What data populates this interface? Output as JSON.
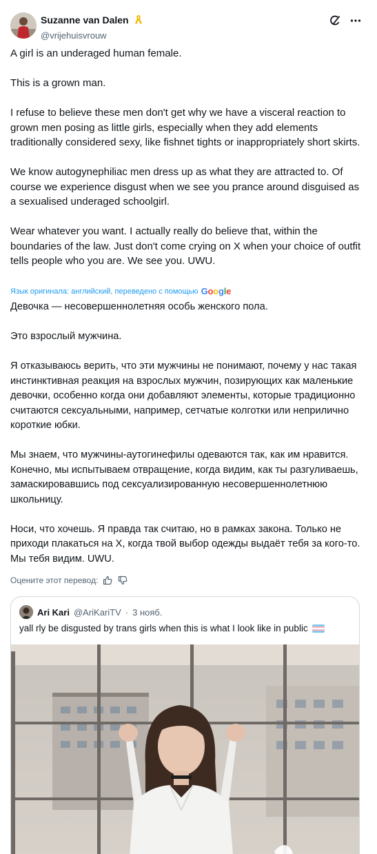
{
  "author": {
    "display_name": "Suzanne van Dalen",
    "handle": "@vrijehuisvrouw",
    "badge_icon": "awareness-ribbon-icon"
  },
  "header_icons": [
    "grok-icon",
    "more-icon"
  ],
  "original_paragraphs": [
    "A girl is an underaged human female.",
    "This is a grown man.",
    "I refuse to believe these men don't get why we have a visceral reaction to grown men posing as little girls, especially when they add elements traditionally considered sexy, like fishnet tights or inappropriately short skirts.",
    "We know autogynephiliac men dress up as what they are attracted to. Of course we experience disgust when we see you prance around disguised as a sexualised underaged schoolgirl.",
    "Wear whatever you want. I actually really do believe that, within the boundaries of the law. Just don't come crying on X when your choice of outfit tells people who you are. We see you. UWU."
  ],
  "translation": {
    "note": "Язык оригинала: английский, переведено с помощью",
    "provider": "Google",
    "paragraphs": [
      "Девочка — несовершеннолетняя особь женского пола.",
      "Это взрослый мужчина.",
      "Я отказываюсь верить, что эти мужчины не понимают, почему у нас такая инстинктивная реакция на взрослых мужчин, позирующих как маленькие девочки, особенно когда они добавляют элементы, которые традиционно считаются сексуальными, например, сетчатые колготки или неприлично короткие юбки.",
      "Мы знаем, что мужчины-аутогинефилы одеваются так, как им нравится. Конечно, мы испытываем отвращение, когда видим, как ты разгуливаешь, замаскировавшись под сексуализированную несовершеннолетнюю школьницу.",
      "Носи, что хочешь. Я правда так считаю, но в рамках закона. Только не приходи плакаться на X, когда твой выбор одежды выдаёт тебя за кого-то. Мы тебя видим. UWU."
    ],
    "rate_label": "Оцените этот перевод:"
  },
  "quote": {
    "display_name": "Ari Kari",
    "handle": "@AriKariTV",
    "separator": "·",
    "date": "3 нояб.",
    "text": "yall rly be disgusted by trans girls when this is what I look like in public",
    "flag_icon": "transgender-flag-icon"
  },
  "colors": {
    "link": "#1d9bf0",
    "secondary": "#536471",
    "primary": "#0f1419",
    "border": "#cfd9de"
  }
}
